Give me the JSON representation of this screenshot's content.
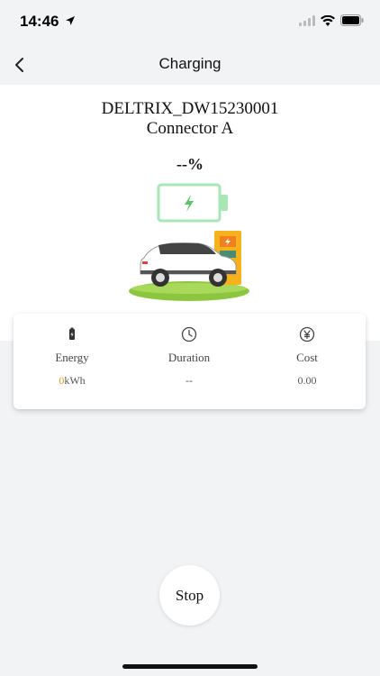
{
  "status": {
    "time": "14:46"
  },
  "nav": {
    "title": "Charging"
  },
  "station": {
    "name": "DELTRIX_DW15230001",
    "connector": "Connector A"
  },
  "charge": {
    "percent": "--%"
  },
  "metrics": {
    "energy": {
      "label": "Energy",
      "value": "0",
      "unit": "kWh",
      "icon": "battery-icon"
    },
    "duration": {
      "label": "Duration",
      "value": "--",
      "icon": "clock-icon"
    },
    "cost": {
      "label": "Cost",
      "value": "0.00",
      "icon": "yen-icon"
    }
  },
  "actions": {
    "stop_label": "Stop"
  },
  "colors": {
    "accent": "#e39b24",
    "battery": "#a9e6b6",
    "bolt": "#5cc36d",
    "grass": "#8cc63f",
    "station": "#f5b21c"
  }
}
